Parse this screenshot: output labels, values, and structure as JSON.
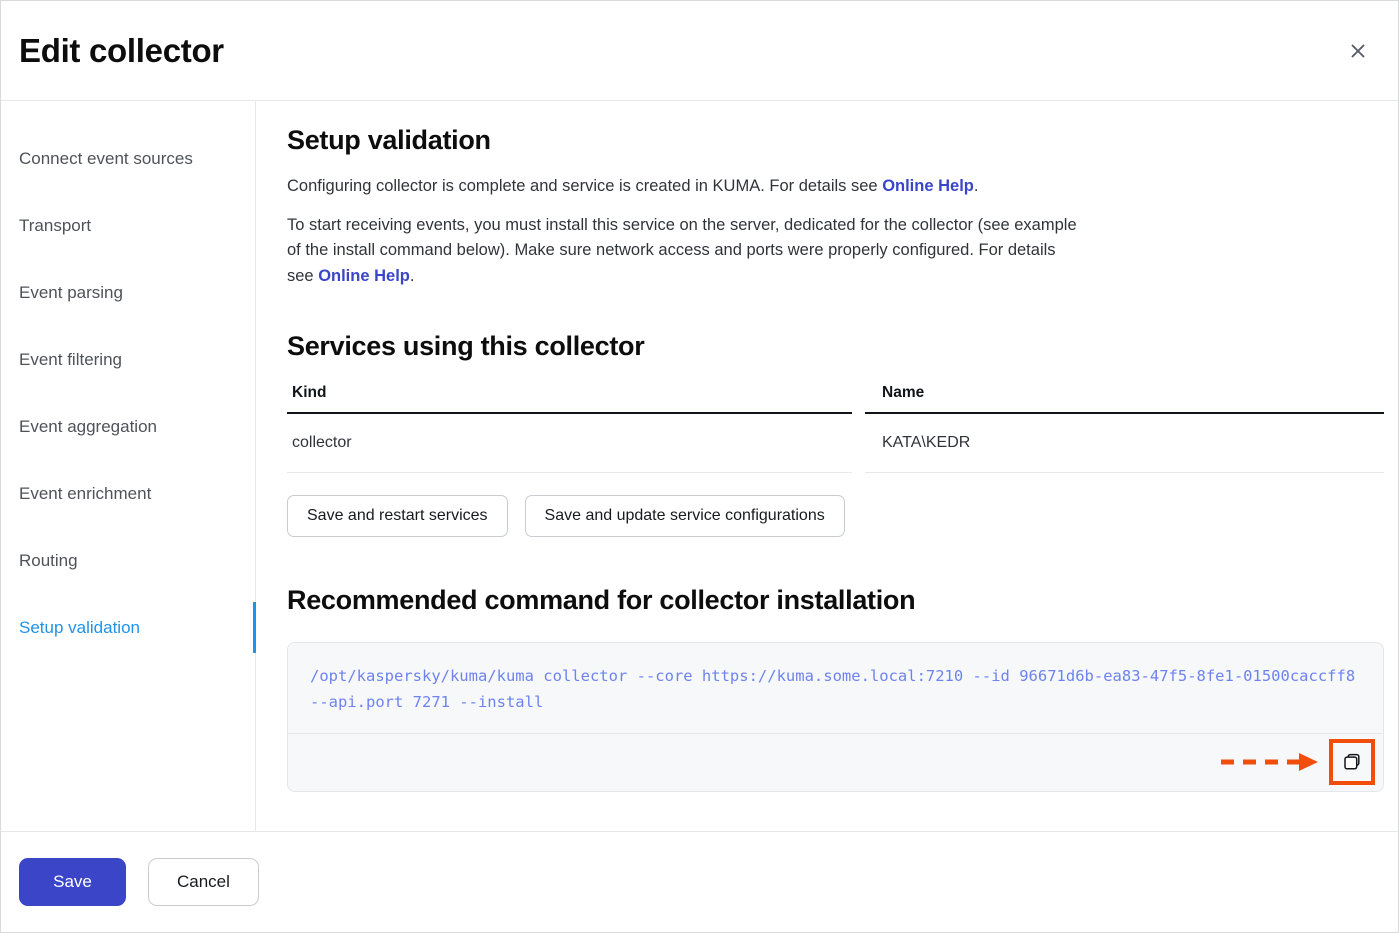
{
  "dialog": {
    "title": "Edit collector",
    "close_icon": "close-icon"
  },
  "sidebar": {
    "items": [
      {
        "label": "Connect event sources",
        "active": false
      },
      {
        "label": "Transport",
        "active": false
      },
      {
        "label": "Event parsing",
        "active": false
      },
      {
        "label": "Event filtering",
        "active": false
      },
      {
        "label": "Event aggregation",
        "active": false
      },
      {
        "label": "Event enrichment",
        "active": false
      },
      {
        "label": "Routing",
        "active": false
      },
      {
        "label": "Setup validation",
        "active": true
      }
    ],
    "active_color": "#1f93e8"
  },
  "main": {
    "section_title": "Setup validation",
    "paragraph1": {
      "before": "Configuring collector is complete and service is created in KUMA. For details see ",
      "link": "Online Help",
      "after": "."
    },
    "paragraph2": {
      "before": "To start receiving events, you must install this service on the server, dedicated for the collector (see example of the install command below). Make sure network access and ports were properly configured. For details see ",
      "link": "Online Help",
      "after": "."
    },
    "services_title": "Services using this collector",
    "table": {
      "columns": [
        "Kind",
        "Name"
      ],
      "rows": [
        {
          "kind": "collector",
          "name": "KATA\\KEDR"
        }
      ]
    },
    "actions": {
      "save_restart": "Save and restart services",
      "save_update": "Save and update service configurations"
    },
    "command_title": "Recommended command for collector installation",
    "command": "/opt/kaspersky/kuma/kuma collector --core https://kuma.some.local:7210 --id 96671d6b-ea83-47f5-8fe1-01500caccff8 --api.port 7271 --install",
    "copy_icon": "copy-icon",
    "annotation_color": "#f24e0b",
    "link_color": "#3a45c8",
    "code_color": "#6e83f0"
  },
  "footer": {
    "save": "Save",
    "cancel": "Cancel",
    "primary_color": "#3a45c8"
  }
}
